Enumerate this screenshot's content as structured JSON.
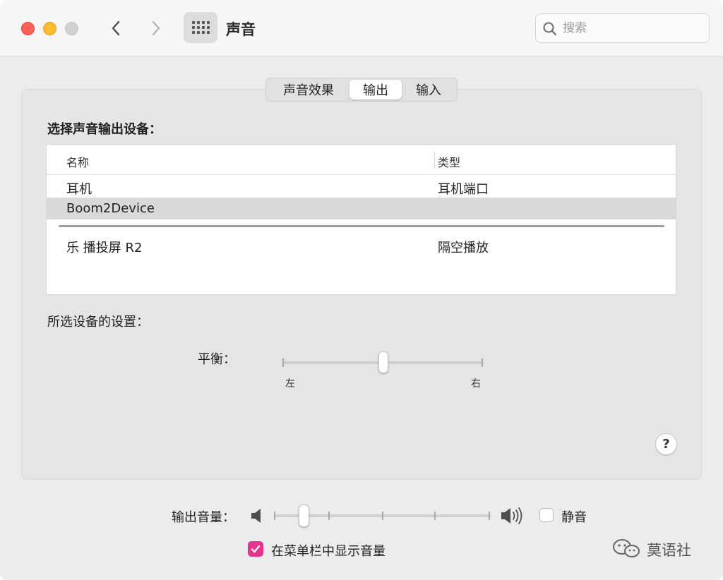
{
  "window": {
    "title": "声音"
  },
  "toolbar": {
    "search": {
      "placeholder": "搜索",
      "value": ""
    }
  },
  "tabs": [
    {
      "label": "声音效果",
      "selected": false
    },
    {
      "label": "输出",
      "selected": true
    },
    {
      "label": "输入",
      "selected": false
    }
  ],
  "output": {
    "select_label": "选择声音输出设备：",
    "table": {
      "columns": [
        "名称",
        "类型"
      ],
      "rows": [
        {
          "name": "耳机",
          "type": "耳机端口",
          "selected": false
        },
        {
          "name": "Boom2Device",
          "type": "",
          "selected": true
        },
        {
          "name": "乐 播投屏 R2",
          "type": "隔空播放",
          "selected": false
        }
      ]
    },
    "settings_label": "所选设备的设置：",
    "balance": {
      "label": "平衡：",
      "left": "左",
      "right": "右",
      "value": 0.5
    },
    "help_label": "?"
  },
  "volume": {
    "label": "输出音量：",
    "value": 0.14,
    "mute_label": "静音",
    "mute_checked": false,
    "show_in_menu_label": "在菜单栏中显示音量",
    "show_in_menu_checked": true
  },
  "watermark": {
    "text": "莫语社"
  },
  "colors": {
    "accent": "#e6338d",
    "close": "#ff5f57",
    "minimize": "#febc2e"
  }
}
